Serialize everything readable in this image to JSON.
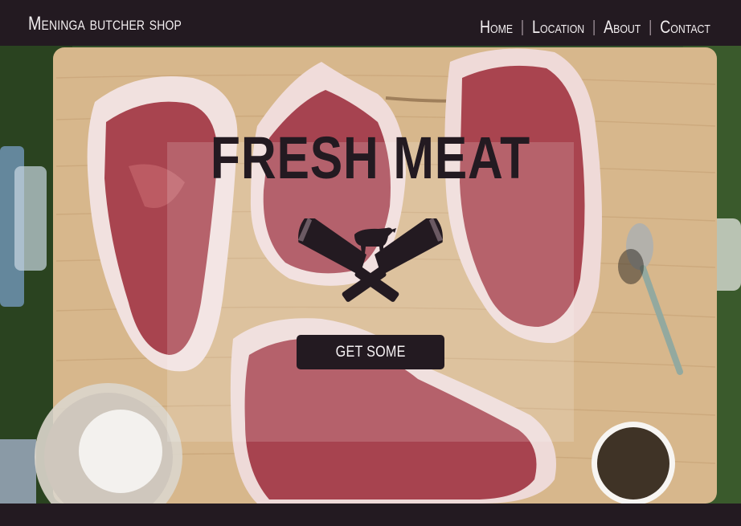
{
  "header": {
    "brand": "Meninga butcher shop",
    "nav": [
      {
        "label": "Home"
      },
      {
        "label": "Location"
      },
      {
        "label": "About"
      },
      {
        "label": "Contact"
      }
    ],
    "separator": "|"
  },
  "hero": {
    "headline": "FRESH MEAT",
    "cta_label": "GET SOME",
    "emblem_icon": "crossed-cleavers-cow-icon"
  },
  "colors": {
    "dark": "#231a21",
    "text_light": "#f2eef0",
    "wood": "#d9b98f",
    "meat": "#a4454f"
  }
}
